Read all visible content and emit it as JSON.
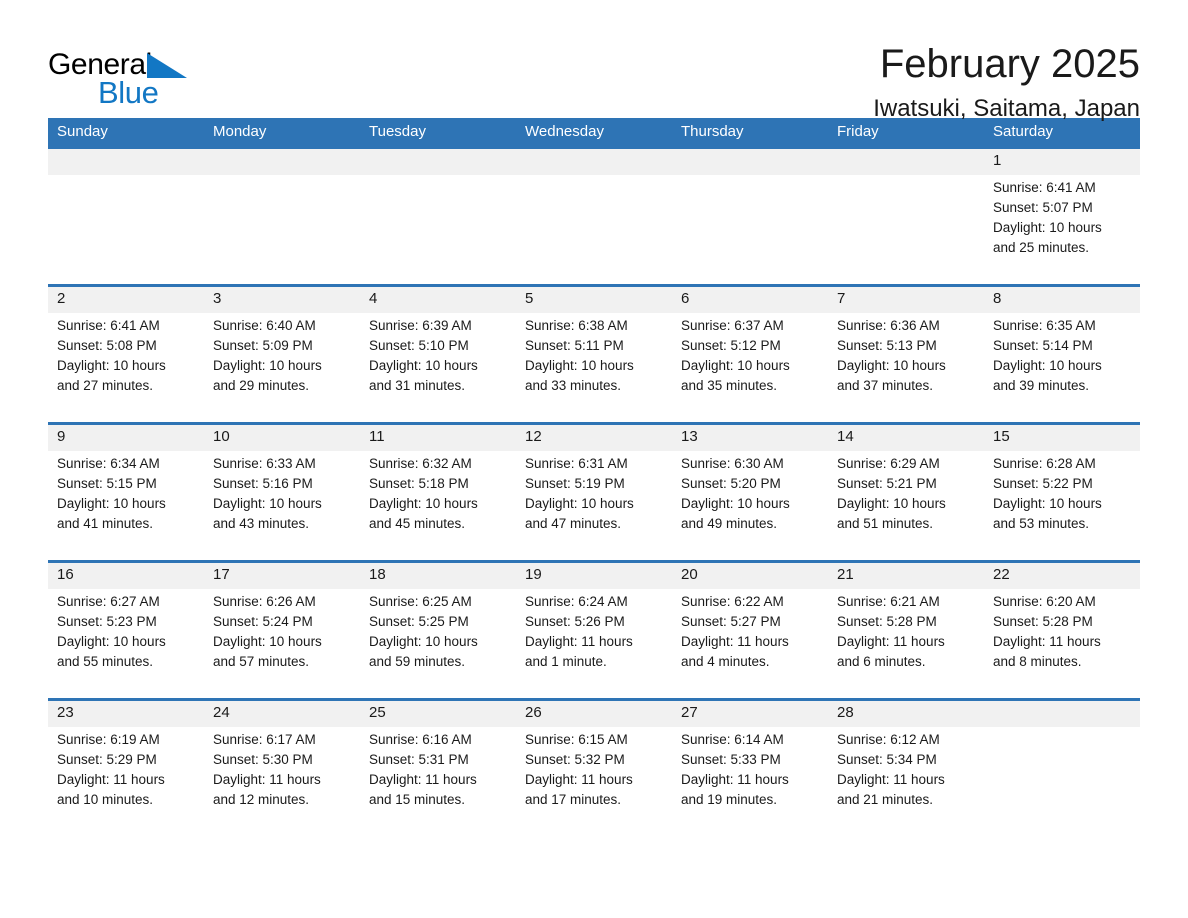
{
  "logo": {
    "text_primary": "General",
    "text_secondary": "Blue",
    "primary_color": "#000000",
    "secondary_color": "#1277c4",
    "flag_color": "#1277c4"
  },
  "header": {
    "month_title": "February 2025",
    "location": "Iwatsuki, Saitama, Japan",
    "accent_color": "#2e74b5",
    "band_color": "#f1f1f1"
  },
  "weekday_headers": [
    "Sunday",
    "Monday",
    "Tuesday",
    "Wednesday",
    "Thursday",
    "Friday",
    "Saturday"
  ],
  "weeks": [
    [
      {
        "day": "",
        "sunrise": "",
        "sunset": "",
        "daylight_line1": "",
        "daylight_line2": ""
      },
      {
        "day": "",
        "sunrise": "",
        "sunset": "",
        "daylight_line1": "",
        "daylight_line2": ""
      },
      {
        "day": "",
        "sunrise": "",
        "sunset": "",
        "daylight_line1": "",
        "daylight_line2": ""
      },
      {
        "day": "",
        "sunrise": "",
        "sunset": "",
        "daylight_line1": "",
        "daylight_line2": ""
      },
      {
        "day": "",
        "sunrise": "",
        "sunset": "",
        "daylight_line1": "",
        "daylight_line2": ""
      },
      {
        "day": "",
        "sunrise": "",
        "sunset": "",
        "daylight_line1": "",
        "daylight_line2": ""
      },
      {
        "day": "1",
        "sunrise": "Sunrise: 6:41 AM",
        "sunset": "Sunset: 5:07 PM",
        "daylight_line1": "Daylight: 10 hours",
        "daylight_line2": "and 25 minutes."
      }
    ],
    [
      {
        "day": "2",
        "sunrise": "Sunrise: 6:41 AM",
        "sunset": "Sunset: 5:08 PM",
        "daylight_line1": "Daylight: 10 hours",
        "daylight_line2": "and 27 minutes."
      },
      {
        "day": "3",
        "sunrise": "Sunrise: 6:40 AM",
        "sunset": "Sunset: 5:09 PM",
        "daylight_line1": "Daylight: 10 hours",
        "daylight_line2": "and 29 minutes."
      },
      {
        "day": "4",
        "sunrise": "Sunrise: 6:39 AM",
        "sunset": "Sunset: 5:10 PM",
        "daylight_line1": "Daylight: 10 hours",
        "daylight_line2": "and 31 minutes."
      },
      {
        "day": "5",
        "sunrise": "Sunrise: 6:38 AM",
        "sunset": "Sunset: 5:11 PM",
        "daylight_line1": "Daylight: 10 hours",
        "daylight_line2": "and 33 minutes."
      },
      {
        "day": "6",
        "sunrise": "Sunrise: 6:37 AM",
        "sunset": "Sunset: 5:12 PM",
        "daylight_line1": "Daylight: 10 hours",
        "daylight_line2": "and 35 minutes."
      },
      {
        "day": "7",
        "sunrise": "Sunrise: 6:36 AM",
        "sunset": "Sunset: 5:13 PM",
        "daylight_line1": "Daylight: 10 hours",
        "daylight_line2": "and 37 minutes."
      },
      {
        "day": "8",
        "sunrise": "Sunrise: 6:35 AM",
        "sunset": "Sunset: 5:14 PM",
        "daylight_line1": "Daylight: 10 hours",
        "daylight_line2": "and 39 minutes."
      }
    ],
    [
      {
        "day": "9",
        "sunrise": "Sunrise: 6:34 AM",
        "sunset": "Sunset: 5:15 PM",
        "daylight_line1": "Daylight: 10 hours",
        "daylight_line2": "and 41 minutes."
      },
      {
        "day": "10",
        "sunrise": "Sunrise: 6:33 AM",
        "sunset": "Sunset: 5:16 PM",
        "daylight_line1": "Daylight: 10 hours",
        "daylight_line2": "and 43 minutes."
      },
      {
        "day": "11",
        "sunrise": "Sunrise: 6:32 AM",
        "sunset": "Sunset: 5:18 PM",
        "daylight_line1": "Daylight: 10 hours",
        "daylight_line2": "and 45 minutes."
      },
      {
        "day": "12",
        "sunrise": "Sunrise: 6:31 AM",
        "sunset": "Sunset: 5:19 PM",
        "daylight_line1": "Daylight: 10 hours",
        "daylight_line2": "and 47 minutes."
      },
      {
        "day": "13",
        "sunrise": "Sunrise: 6:30 AM",
        "sunset": "Sunset: 5:20 PM",
        "daylight_line1": "Daylight: 10 hours",
        "daylight_line2": "and 49 minutes."
      },
      {
        "day": "14",
        "sunrise": "Sunrise: 6:29 AM",
        "sunset": "Sunset: 5:21 PM",
        "daylight_line1": "Daylight: 10 hours",
        "daylight_line2": "and 51 minutes."
      },
      {
        "day": "15",
        "sunrise": "Sunrise: 6:28 AM",
        "sunset": "Sunset: 5:22 PM",
        "daylight_line1": "Daylight: 10 hours",
        "daylight_line2": "and 53 minutes."
      }
    ],
    [
      {
        "day": "16",
        "sunrise": "Sunrise: 6:27 AM",
        "sunset": "Sunset: 5:23 PM",
        "daylight_line1": "Daylight: 10 hours",
        "daylight_line2": "and 55 minutes."
      },
      {
        "day": "17",
        "sunrise": "Sunrise: 6:26 AM",
        "sunset": "Sunset: 5:24 PM",
        "daylight_line1": "Daylight: 10 hours",
        "daylight_line2": "and 57 minutes."
      },
      {
        "day": "18",
        "sunrise": "Sunrise: 6:25 AM",
        "sunset": "Sunset: 5:25 PM",
        "daylight_line1": "Daylight: 10 hours",
        "daylight_line2": "and 59 minutes."
      },
      {
        "day": "19",
        "sunrise": "Sunrise: 6:24 AM",
        "sunset": "Sunset: 5:26 PM",
        "daylight_line1": "Daylight: 11 hours",
        "daylight_line2": "and 1 minute."
      },
      {
        "day": "20",
        "sunrise": "Sunrise: 6:22 AM",
        "sunset": "Sunset: 5:27 PM",
        "daylight_line1": "Daylight: 11 hours",
        "daylight_line2": "and 4 minutes."
      },
      {
        "day": "21",
        "sunrise": "Sunrise: 6:21 AM",
        "sunset": "Sunset: 5:28 PM",
        "daylight_line1": "Daylight: 11 hours",
        "daylight_line2": "and 6 minutes."
      },
      {
        "day": "22",
        "sunrise": "Sunrise: 6:20 AM",
        "sunset": "Sunset: 5:28 PM",
        "daylight_line1": "Daylight: 11 hours",
        "daylight_line2": "and 8 minutes."
      }
    ],
    [
      {
        "day": "23",
        "sunrise": "Sunrise: 6:19 AM",
        "sunset": "Sunset: 5:29 PM",
        "daylight_line1": "Daylight: 11 hours",
        "daylight_line2": "and 10 minutes."
      },
      {
        "day": "24",
        "sunrise": "Sunrise: 6:17 AM",
        "sunset": "Sunset: 5:30 PM",
        "daylight_line1": "Daylight: 11 hours",
        "daylight_line2": "and 12 minutes."
      },
      {
        "day": "25",
        "sunrise": "Sunrise: 6:16 AM",
        "sunset": "Sunset: 5:31 PM",
        "daylight_line1": "Daylight: 11 hours",
        "daylight_line2": "and 15 minutes."
      },
      {
        "day": "26",
        "sunrise": "Sunrise: 6:15 AM",
        "sunset": "Sunset: 5:32 PM",
        "daylight_line1": "Daylight: 11 hours",
        "daylight_line2": "and 17 minutes."
      },
      {
        "day": "27",
        "sunrise": "Sunrise: 6:14 AM",
        "sunset": "Sunset: 5:33 PM",
        "daylight_line1": "Daylight: 11 hours",
        "daylight_line2": "and 19 minutes."
      },
      {
        "day": "28",
        "sunrise": "Sunrise: 6:12 AM",
        "sunset": "Sunset: 5:34 PM",
        "daylight_line1": "Daylight: 11 hours",
        "daylight_line2": "and 21 minutes."
      },
      {
        "day": "",
        "sunrise": "",
        "sunset": "",
        "daylight_line1": "",
        "daylight_line2": ""
      }
    ]
  ]
}
